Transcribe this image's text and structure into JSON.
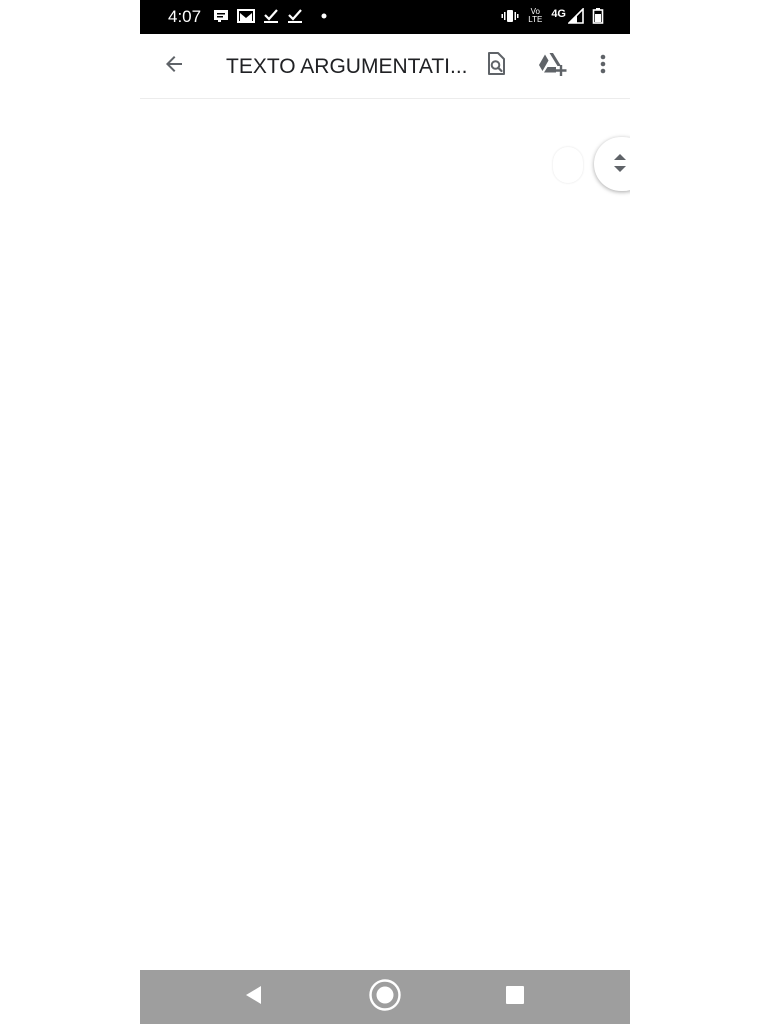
{
  "status_bar": {
    "time": "4:07",
    "lte_label_top": "Vo",
    "lte_label_bottom": "LTE",
    "network": "4G",
    "left_icons": [
      "message-icon",
      "gmail-icon",
      "task-done-icon",
      "task-done-icon",
      "dot-icon"
    ],
    "right_icons": [
      "vibrate-icon",
      "volte-icon",
      "signal-icon",
      "battery-icon"
    ]
  },
  "app_bar": {
    "title": "TEXTO ARGUMENTATI...",
    "icons": [
      "arrow-back-icon",
      "find-in-page-icon",
      "add-to-drive-icon",
      "more-vert-icon"
    ]
  },
  "content": {
    "scroll_handle_icon": "unfold-more-icon"
  },
  "nav_bar": {
    "icons": [
      "nav-back-icon",
      "nav-home-icon",
      "nav-recents-icon"
    ]
  },
  "colors": {
    "status_bar_bg": "#000000",
    "nav_bar_bg": "#9e9e9e",
    "icon_gray": "#5f6368",
    "title_text": "#202124"
  }
}
